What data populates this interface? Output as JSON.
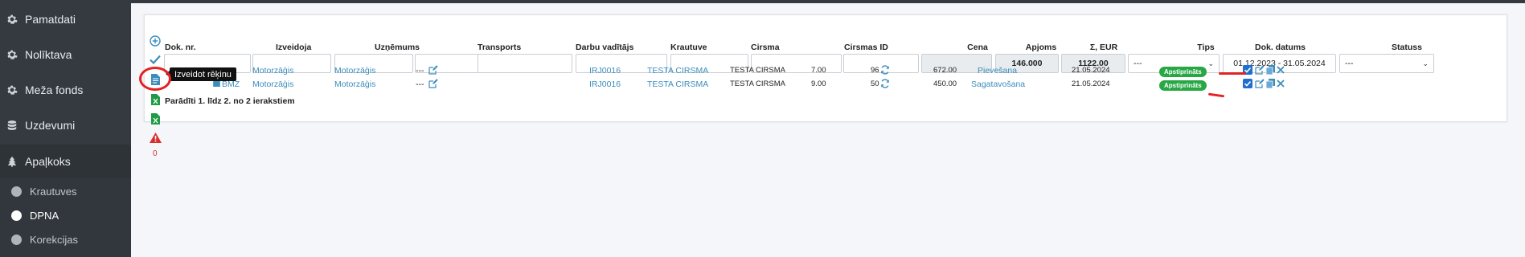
{
  "sidebar": {
    "items": [
      {
        "label": "Pamatdati",
        "icon": "gear-icon"
      },
      {
        "label": "Nolīktava",
        "icon": "gear-icon"
      },
      {
        "label": "Meža fonds",
        "icon": "gear-icon"
      },
      {
        "label": "Uzdevumi",
        "icon": "database-icon"
      },
      {
        "label": "Apaļkoks",
        "icon": "tree-icon"
      }
    ],
    "subitems": [
      {
        "label": "Krautuves"
      },
      {
        "label": "DPNA"
      },
      {
        "label": "Korekcijas"
      }
    ]
  },
  "table": {
    "headers": {
      "dok_nr": "Dok. nr.",
      "izveidoja": "Izveidoja",
      "uznemums": "Uzņēmums",
      "transports": "Transports",
      "darbu_vaditajs": "Darbu vadītājs",
      "krautuve": "Krautuve",
      "cirsma": "Cirsma",
      "cirsmas_id": "Cirsmas ID",
      "cena": "Cena",
      "apjoms": "Apjoms",
      "summa": "Σ, EUR",
      "tips": "Tips",
      "dok_datums": "Dok. datums",
      "statuss": "Statuss"
    },
    "filters": {
      "apjoms_total": "146.000",
      "summa_total": "1122.00",
      "tips_select": "---",
      "date_range": "01.12.2023 - 31.05.2024",
      "status_select": "---"
    },
    "rows": [
      {
        "izveidoja": "Motorzāģis",
        "uznemums": "Motorzāģis",
        "transports": "---",
        "krautuve": "IRJ0016",
        "cirsma": "TESTA CIRSMA",
        "cirsmas_id": "TESTA CIRSMA",
        "cena": "7.00",
        "apjoms": "96",
        "summa": "672.00",
        "tips": "Pievešana",
        "datums": "21.05.2024",
        "statuss": "Apstiprināts"
      },
      {
        "dok_suffix": "BMZ",
        "izveidoja": "Motorzāģis",
        "uznemums": "Motorzāģis",
        "transports": "---",
        "krautuve": "IRJ0016",
        "cirsma": "TESTA CIRSMA",
        "cirsmas_id": "TESTA CIRSMA",
        "cena": "9.00",
        "apjoms": "50",
        "summa": "450.00",
        "tips": "Sagatavošana",
        "datums": "21.05.2024",
        "statuss": "Apstiprināts"
      }
    ],
    "pager_text": "Parādīti 1. līdz 2. no 2 ierakstiem"
  },
  "tooltip": "Izveidot rēķinu",
  "error_count": "0",
  "colors": {
    "accent": "#3c8dbc",
    "success": "#28a745",
    "danger": "#d9302c",
    "annotation": "#e32222",
    "sidebar": "#343a40"
  }
}
